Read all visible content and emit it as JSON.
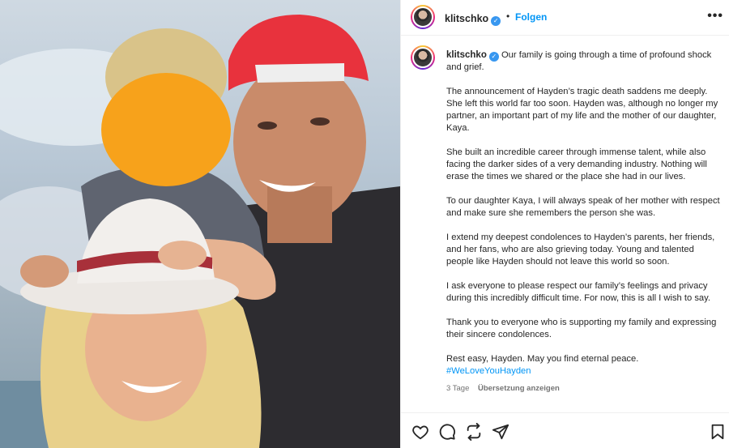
{
  "header": {
    "username": "klitschko",
    "separator": "•",
    "follow_label": "Folgen",
    "more_label": "•••"
  },
  "caption": {
    "username": "klitschko",
    "paragraphs": [
      "Our family is going through a time of profound shock and grief.",
      "The announcement of Hayden’s tragic death saddens me deeply. She left this world far too soon. Hayden was, although no longer my partner, an important part of my life and the mother of our daughter, Kaya.",
      "She built an incredible career through immense talent, while also facing the darker sides of a very demanding industry. Nothing will erase the times we shared or the place she had in our lives.",
      "To our daughter Kaya, I will always speak of her mother with respect and make sure she remembers the person she was.",
      "I extend my deepest condolences to Hayden’s parents, her friends, and her fans, who are also grieving today. Young and talented people like Hayden should not leave this world so soon.",
      "I ask everyone to please respect our family’s feelings and privacy during this incredibly difficult time. For now, this is all I wish to say.",
      "Thank you to everyone who is supporting my family and expressing their sincere condolences."
    ],
    "closing": "Rest easy, Hayden. May you find eternal peace.",
    "hashtag": "#WeLoveYouHayden",
    "time": "3 Tage",
    "translate_label": "Übersetzung anzeigen"
  },
  "icons": {
    "like": "heart-icon",
    "comment": "comment-icon",
    "share": "share-icon",
    "send": "send-icon",
    "save": "bookmark-icon"
  },
  "colors": {
    "accent": "#0095f6",
    "verified": "#3897f0",
    "text": "#262626",
    "muted": "#737373",
    "face_blur": "#f7a21b"
  }
}
